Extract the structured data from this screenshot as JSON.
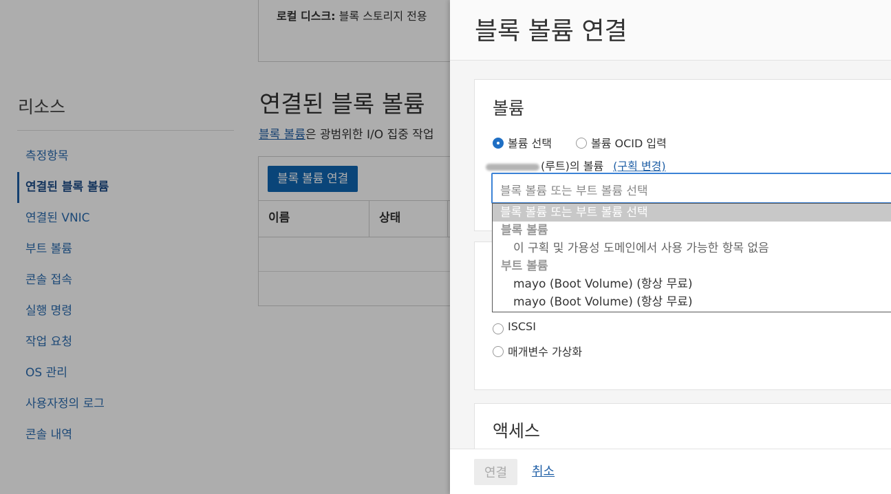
{
  "background": {
    "local_disk": {
      "label": "로컬 디스크:",
      "text": "블록 스토리지 전용"
    },
    "resources": {
      "title": "리소스",
      "items": [
        {
          "label": "측정항목"
        },
        {
          "label": "연결된 블록 볼륨",
          "active": true
        },
        {
          "label": "연결된 VNIC"
        },
        {
          "label": "부트 볼륨"
        },
        {
          "label": "콘솔 접속"
        },
        {
          "label": "실행 명령"
        },
        {
          "label": "작업 요청"
        },
        {
          "label": "OS 관리"
        },
        {
          "label": "사용자정의 로그"
        },
        {
          "label": "콘솔 내역"
        }
      ]
    },
    "attached": {
      "title": "연결된 블록 볼륨",
      "desc_link": "블록 볼륨",
      "desc_text": "은 광범위한 I/O 집중 작업",
      "button": "블록 볼륨 연결",
      "columns": [
        "이름",
        "상태"
      ]
    }
  },
  "panel": {
    "title": "블록 볼륨 연결",
    "volume_section": {
      "title": "볼륨",
      "radio_select": "볼륨 선택",
      "radio_ocid": "볼륨 OCID 입력",
      "compartment_suffix": "(루트)의 볼륨",
      "change_link": "(구획 변경)",
      "select_placeholder": "블록 볼륨 또는 부트 볼륨 선택"
    },
    "dropdown": {
      "selected": "블록 볼륨 또는 부트 볼륨 선택",
      "group_block": "블록 볼륨",
      "block_empty": "이 구획 및 가용성 도메인에서 사용 가능한 항목 없음",
      "group_boot": "부트 볼륨",
      "boot_options": [
        "mayo (Boot Volume) (항상 무료)",
        "mayo (Boot Volume) (항상 무료)"
      ]
    },
    "attachment_type": {
      "iscsi": "ISCSI",
      "paravirtualized": "매개변수 가상화"
    },
    "access_section": {
      "title": "액세스"
    },
    "footer": {
      "connect": "연결",
      "cancel": "취소"
    }
  }
}
